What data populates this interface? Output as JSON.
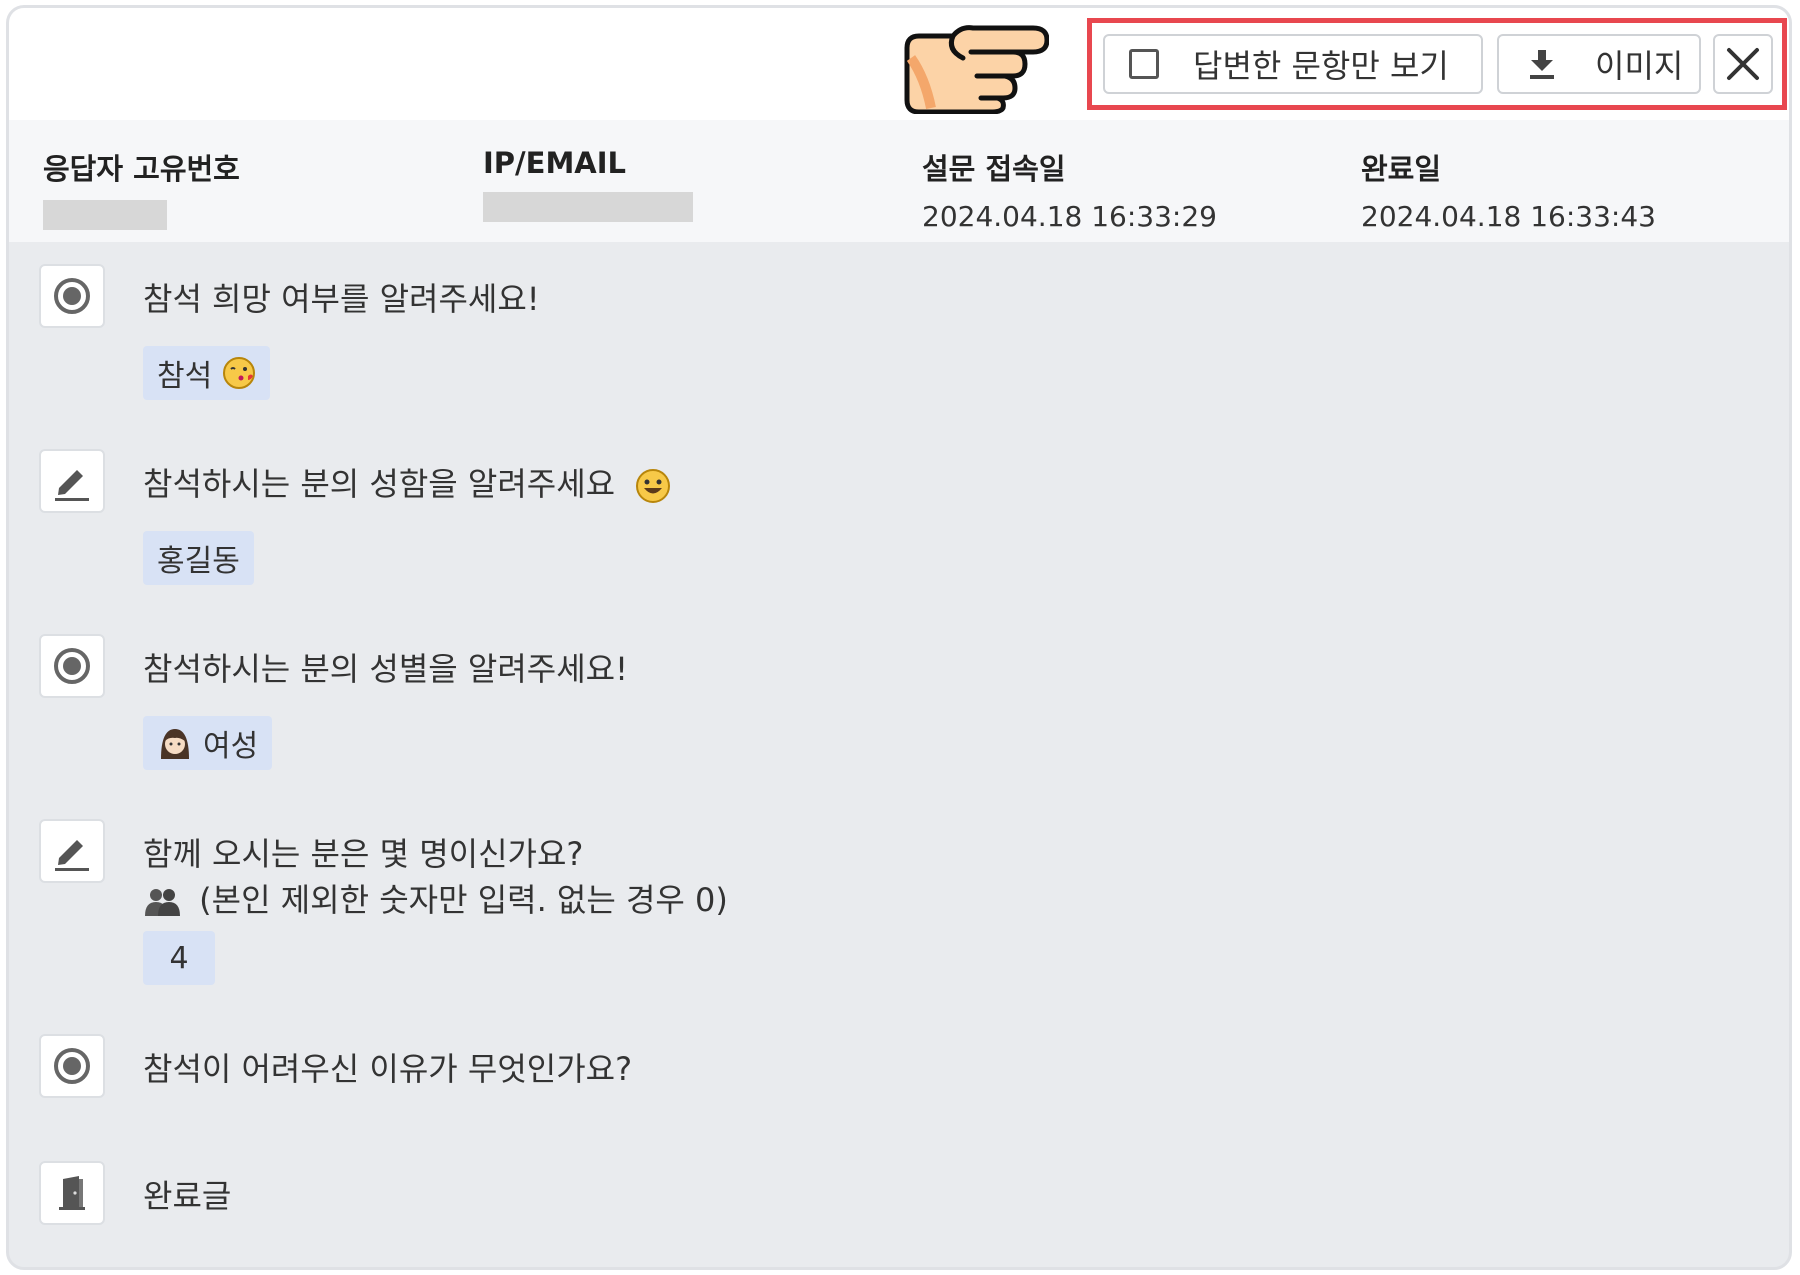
{
  "toolbar": {
    "filter_label": "답변한 문항만 보기",
    "image_label": "이미지",
    "filter_checked": false
  },
  "info": {
    "respondent_id_label": "응답자 고유번호",
    "ip_email_label": "IP/EMAIL",
    "access_date_label": "설문 접속일",
    "access_date_value": "2024.04.18 16:33:29",
    "complete_date_label": "완료일",
    "complete_date_value": "2024.04.18 16:33:43"
  },
  "questions": [
    {
      "type": "radio",
      "text": "참석 희망 여부를 알려주세요!",
      "answer": "참석"
    },
    {
      "type": "text",
      "text": "참석하시는 분의 성함을 알려주세요",
      "answer": "홍길동"
    },
    {
      "type": "radio",
      "text": "참석하시는 분의 성별을 알려주세요!",
      "answer": "여성"
    },
    {
      "type": "text",
      "text_line1": "함께 오시는 분은 몇 명이신가요?",
      "text_line2": "(본인 제외한 숫자만 입력. 없는 경우 0)",
      "answer": "4"
    },
    {
      "type": "radio",
      "text": "참석이 어려우신 이유가 무엇인가요?"
    },
    {
      "type": "end",
      "text": "완료글"
    }
  ],
  "colors": {
    "highlight": "#e8474f",
    "answer_bg": "#d8e2f5",
    "panel_bg": "#e9ebee"
  },
  "icons": [
    "pointing-hand-icon",
    "checkbox-icon",
    "download-icon",
    "close-icon",
    "radio-icon",
    "pencil-icon",
    "door-icon",
    "kiss-emoji",
    "grin-emoji",
    "woman-emoji",
    "people-emoji"
  ]
}
